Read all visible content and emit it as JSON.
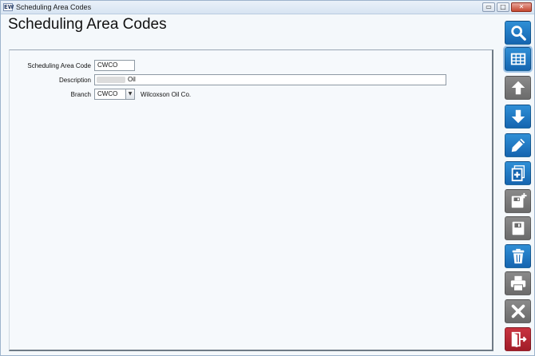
{
  "window": {
    "title": "Scheduling Area Codes",
    "app_icon_text": "EW",
    "minimize_glyph": "▭",
    "maximize_glyph": "□",
    "close_glyph": "✕"
  },
  "page": {
    "title": "Scheduling Area Codes"
  },
  "form": {
    "code": {
      "label": "Scheduling Area Code",
      "value": "CWCO"
    },
    "description": {
      "label": "Description",
      "value": "Oil"
    },
    "branch": {
      "label": "Branch",
      "value": "CWCO",
      "name": "Wilcoxson Oil Co.",
      "dropdown_glyph": "▼"
    }
  },
  "toolbar": {
    "buttons": [
      {
        "name": "search",
        "icon": "search-icon",
        "color": "#1e78c8"
      },
      {
        "name": "grid-view",
        "icon": "grid-icon",
        "color": "#1e78c8",
        "active": true
      },
      {
        "name": "previous",
        "icon": "arrow-up-icon",
        "color": "#7a7a7a"
      },
      {
        "name": "next",
        "icon": "arrow-down-icon",
        "color": "#1e78c8"
      },
      {
        "name": "edit",
        "icon": "pencil-icon",
        "color": "#1e78c8"
      },
      {
        "name": "add-new",
        "icon": "document-plus-icon",
        "color": "#1e78c8"
      },
      {
        "name": "save-new",
        "icon": "floppy-plus-icon",
        "color": "#7a7a7a"
      },
      {
        "name": "save",
        "icon": "floppy-icon",
        "color": "#7a7a7a"
      },
      {
        "name": "delete",
        "icon": "trash-icon",
        "color": "#1e78c8"
      },
      {
        "name": "print",
        "icon": "printer-icon",
        "color": "#7a7a7a"
      },
      {
        "name": "cancel",
        "icon": "close-icon",
        "color": "#7a7a7a"
      },
      {
        "name": "exit",
        "icon": "exit-door-icon",
        "color": "#b52532"
      }
    ]
  }
}
